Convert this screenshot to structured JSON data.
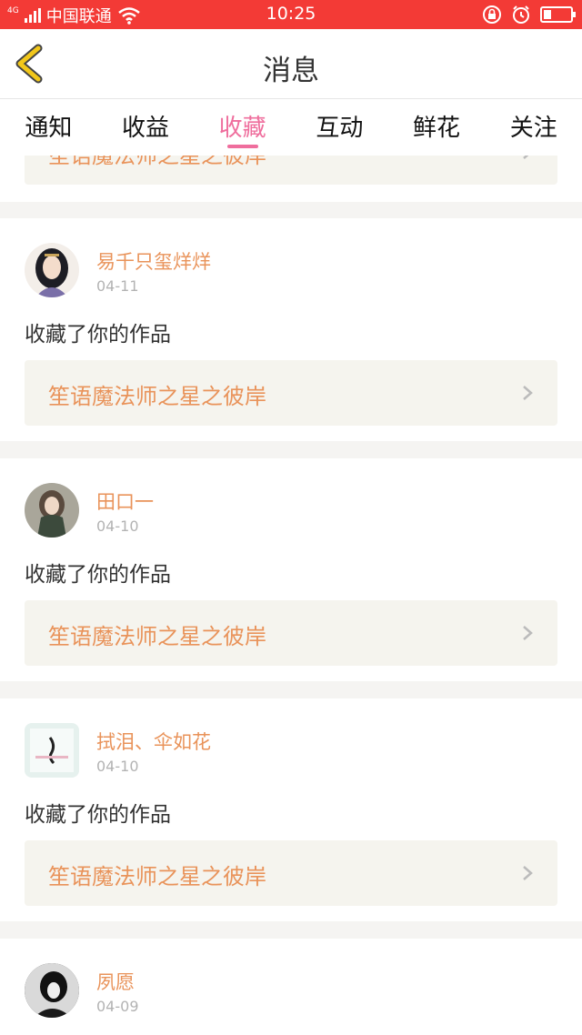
{
  "status_bar": {
    "network": "4G",
    "carrier": "中国联通",
    "time": "10:25",
    "battery_level": 0.25
  },
  "header": {
    "title": "消息"
  },
  "tabs": [
    {
      "label": "通知"
    },
    {
      "label": "收益"
    },
    {
      "label": "收藏"
    },
    {
      "label": "互动"
    },
    {
      "label": "鲜花"
    },
    {
      "label": "关注"
    }
  ],
  "active_tab": "收藏",
  "feed": {
    "partial_top_item": {
      "work_title": "笙语魔法师之星之彼岸"
    },
    "items": [
      {
        "user": "易千只玺烊烊",
        "date": "04-11",
        "action": "收藏了你的作品",
        "work_title": "笙语魔法师之星之彼岸"
      },
      {
        "user": "田口一",
        "date": "04-10",
        "action": "收藏了你的作品",
        "work_title": "笙语魔法师之星之彼岸"
      },
      {
        "user": "拭泪、伞如花",
        "date": "04-10",
        "action": "收藏了你的作品",
        "work_title": "笙语魔法师之星之彼岸"
      },
      {
        "user": "夙愿",
        "date": "04-09"
      }
    ]
  },
  "colors": {
    "status_bar": "#f33a36",
    "accent_pink": "#ef6e9d",
    "username_orange": "#e9935a",
    "back_arrow_yellow": "#f2c71a",
    "work_box_bg": "#f5f4ee"
  }
}
